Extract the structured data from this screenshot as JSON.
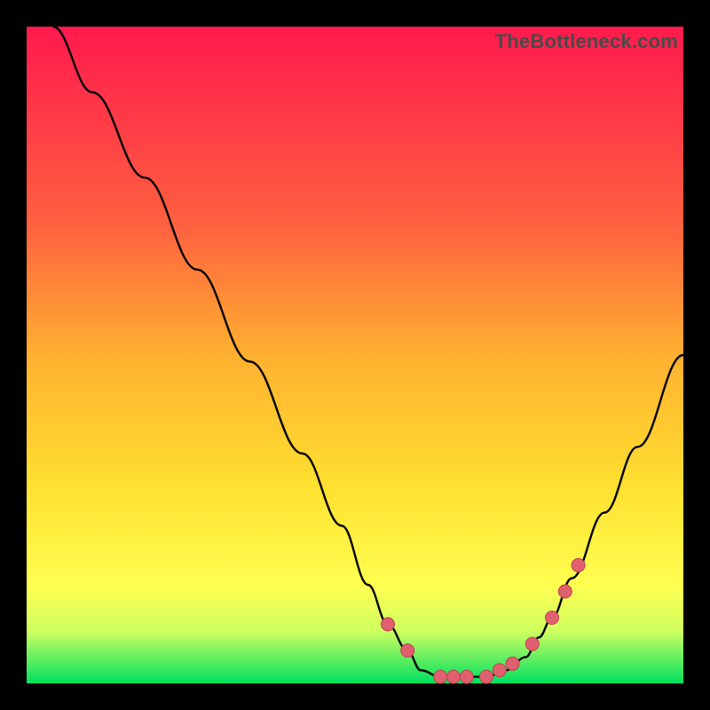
{
  "attribution": "TheBottleneck.com",
  "colors": {
    "curve": "#000000",
    "dot_fill": "#e06070",
    "dot_stroke": "#c04050"
  },
  "chart_data": {
    "type": "line",
    "title": "",
    "xlabel": "",
    "ylabel": "",
    "xlim": [
      0,
      100
    ],
    "ylim": [
      0,
      100
    ],
    "x": [
      4,
      10,
      18,
      26,
      34,
      42,
      48,
      52,
      55,
      58,
      60,
      63,
      66,
      70,
      73,
      76,
      78,
      80,
      83,
      88,
      93,
      100
    ],
    "values": [
      100,
      90,
      77,
      63,
      49,
      35,
      24,
      15,
      9,
      5,
      2,
      1,
      1,
      1,
      2,
      4,
      7,
      10,
      16,
      26,
      36,
      50
    ],
    "series": [
      {
        "name": "bottleneck-curve",
        "x": [
          4,
          10,
          18,
          26,
          34,
          42,
          48,
          52,
          55,
          58,
          60,
          63,
          66,
          70,
          73,
          76,
          78,
          80,
          83,
          88,
          93,
          100
        ],
        "values": [
          100,
          90,
          77,
          63,
          49,
          35,
          24,
          15,
          9,
          5,
          2,
          1,
          1,
          1,
          2,
          4,
          7,
          10,
          16,
          26,
          36,
          50
        ]
      },
      {
        "name": "highlight-dots",
        "x": [
          55,
          58,
          63,
          65,
          67,
          70,
          72,
          74,
          77,
          80,
          82,
          84
        ],
        "values": [
          9,
          5,
          1,
          1,
          1,
          1,
          2,
          3,
          6,
          10,
          14,
          18
        ]
      }
    ]
  }
}
